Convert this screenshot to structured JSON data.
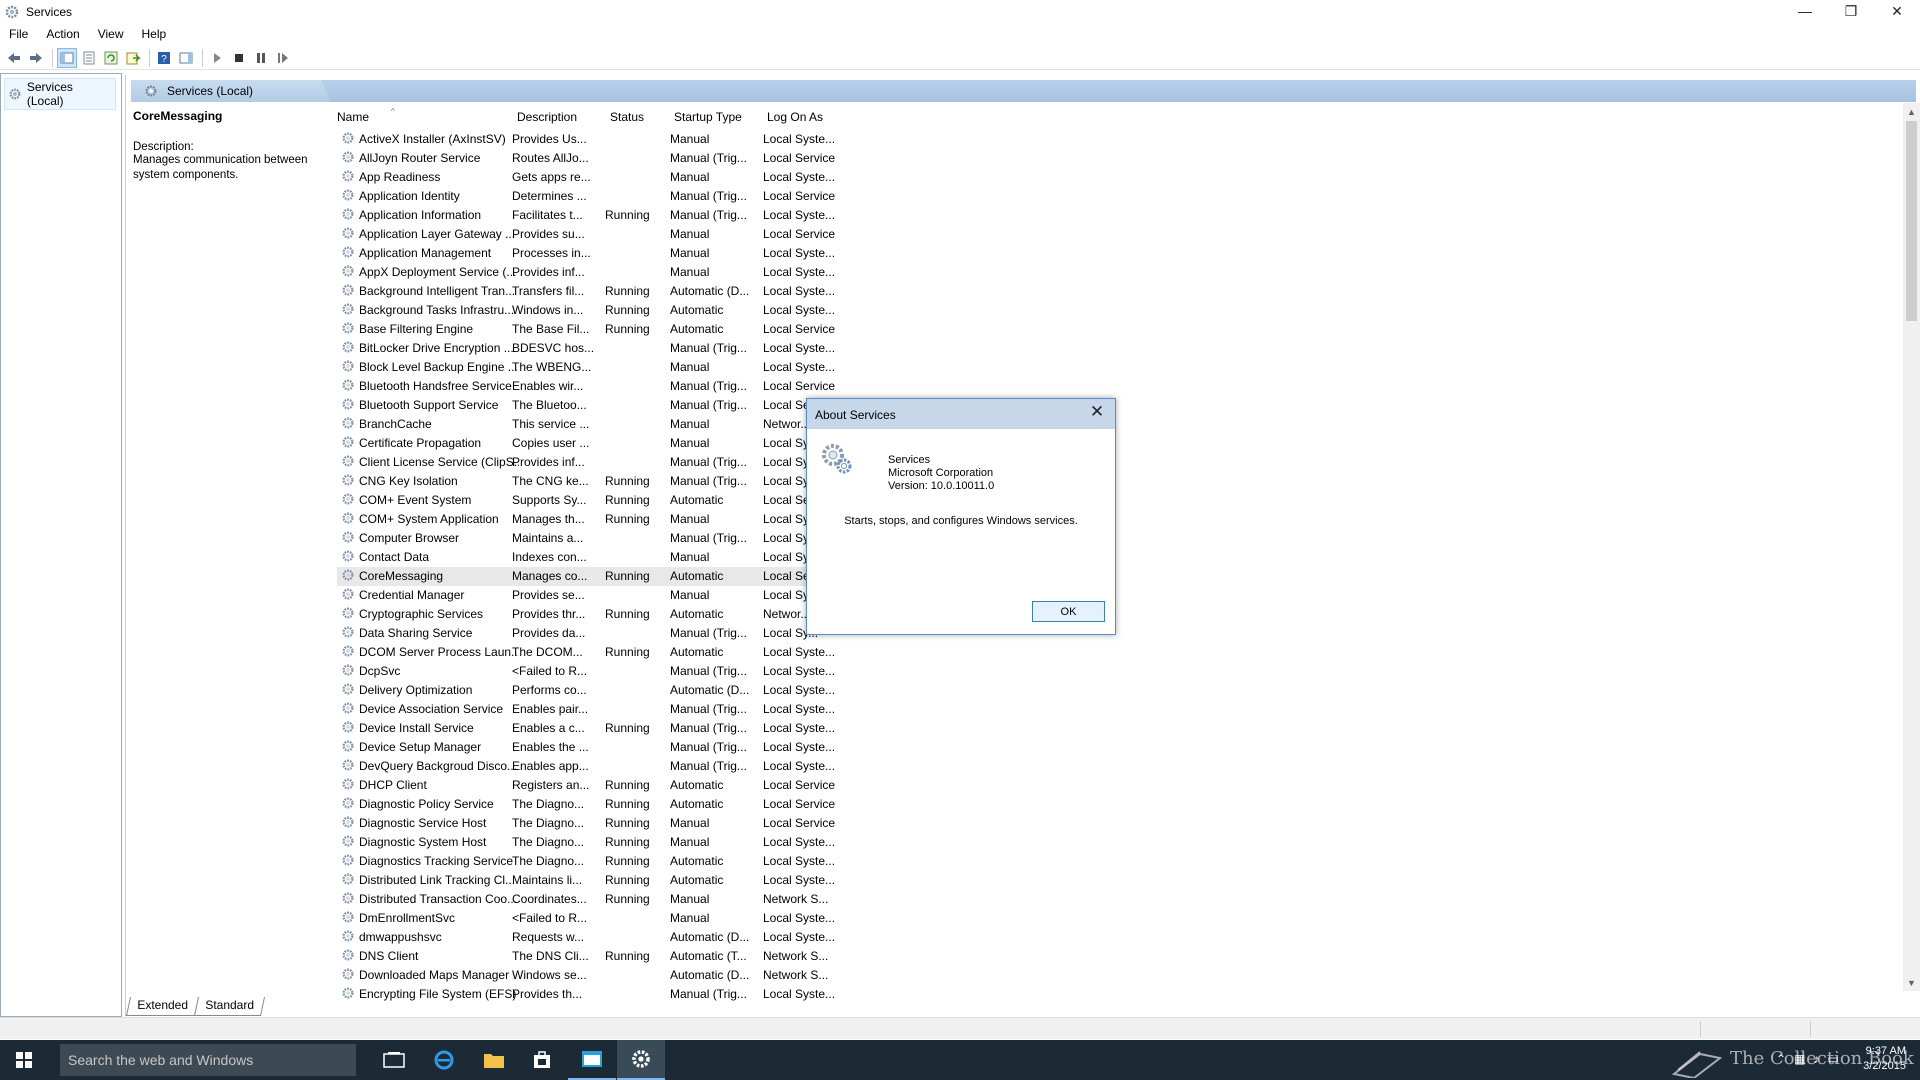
{
  "window": {
    "title": "Services",
    "minimize": "—",
    "restore": "❐",
    "close": "✕"
  },
  "menu": [
    "File",
    "Action",
    "View",
    "Help"
  ],
  "tree": {
    "root_label": "Services (Local)"
  },
  "pane": {
    "header_title": "Services (Local)",
    "selected_service": "CoreMessaging",
    "description_label": "Description:",
    "description_text": "Manages communication between system components."
  },
  "columns": [
    "Name",
    "Description",
    "Status",
    "Startup Type",
    "Log On As"
  ],
  "services": [
    [
      "ActiveX Installer (AxInstSV)",
      "Provides Us...",
      "",
      "Manual",
      "Local Syste..."
    ],
    [
      "AllJoyn Router Service",
      "Routes AllJo...",
      "",
      "Manual (Trig...",
      "Local Service"
    ],
    [
      "App Readiness",
      "Gets apps re...",
      "",
      "Manual",
      "Local Syste..."
    ],
    [
      "Application Identity",
      "Determines ...",
      "",
      "Manual (Trig...",
      "Local Service"
    ],
    [
      "Application Information",
      "Facilitates t...",
      "Running",
      "Manual (Trig...",
      "Local Syste..."
    ],
    [
      "Application Layer Gateway ...",
      "Provides su...",
      "",
      "Manual",
      "Local Service"
    ],
    [
      "Application Management",
      "Processes in...",
      "",
      "Manual",
      "Local Syste..."
    ],
    [
      "AppX Deployment Service (...",
      "Provides inf...",
      "",
      "Manual",
      "Local Syste..."
    ],
    [
      "Background Intelligent Tran...",
      "Transfers fil...",
      "Running",
      "Automatic (D...",
      "Local Syste..."
    ],
    [
      "Background Tasks Infrastru...",
      "Windows in...",
      "Running",
      "Automatic",
      "Local Syste..."
    ],
    [
      "Base Filtering Engine",
      "The Base Fil...",
      "Running",
      "Automatic",
      "Local Service"
    ],
    [
      "BitLocker Drive Encryption ...",
      "BDESVC hos...",
      "",
      "Manual (Trig...",
      "Local Syste..."
    ],
    [
      "Block Level Backup Engine ...",
      "The WBENG...",
      "",
      "Manual",
      "Local Syste..."
    ],
    [
      "Bluetooth Handsfree Service",
      "Enables wir...",
      "",
      "Manual (Trig...",
      "Local Service"
    ],
    [
      "Bluetooth Support Service",
      "The Bluetoo...",
      "",
      "Manual (Trig...",
      "Local Se..."
    ],
    [
      "BranchCache",
      "This service ...",
      "",
      "Manual",
      "Networ..."
    ],
    [
      "Certificate Propagation",
      "Copies user ...",
      "",
      "Manual",
      "Local Sy..."
    ],
    [
      "Client License Service (ClipS...",
      "Provides inf...",
      "",
      "Manual (Trig...",
      "Local Sy..."
    ],
    [
      "CNG Key Isolation",
      "The CNG ke...",
      "Running",
      "Manual (Trig...",
      "Local Sy..."
    ],
    [
      "COM+ Event System",
      "Supports Sy...",
      "Running",
      "Automatic",
      "Local Se..."
    ],
    [
      "COM+ System Application",
      "Manages th...",
      "Running",
      "Manual",
      "Local Sy..."
    ],
    [
      "Computer Browser",
      "Maintains a...",
      "",
      "Manual (Trig...",
      "Local Sy..."
    ],
    [
      "Contact Data",
      "Indexes con...",
      "",
      "Manual",
      "Local Sy..."
    ],
    [
      "CoreMessaging",
      "Manages co...",
      "Running",
      "Automatic",
      "Local Se..."
    ],
    [
      "Credential Manager",
      "Provides se...",
      "",
      "Manual",
      "Local Sy..."
    ],
    [
      "Cryptographic Services",
      "Provides thr...",
      "Running",
      "Automatic",
      "Networ..."
    ],
    [
      "Data Sharing Service",
      "Provides da...",
      "",
      "Manual (Trig...",
      "Local Sy..."
    ],
    [
      "DCOM Server Process Laun...",
      "The DCOM...",
      "Running",
      "Automatic",
      "Local Syste..."
    ],
    [
      "DcpSvc",
      "<Failed to R...",
      "",
      "Manual (Trig...",
      "Local Syste..."
    ],
    [
      "Delivery Optimization",
      "Performs co...",
      "",
      "Automatic (D...",
      "Local Syste..."
    ],
    [
      "Device Association Service",
      "Enables pair...",
      "",
      "Manual (Trig...",
      "Local Syste..."
    ],
    [
      "Device Install Service",
      "Enables a c...",
      "Running",
      "Manual (Trig...",
      "Local Syste..."
    ],
    [
      "Device Setup Manager",
      "Enables the ...",
      "",
      "Manual (Trig...",
      "Local Syste..."
    ],
    [
      "DevQuery Backgroud Disco...",
      "Enables app...",
      "",
      "Manual (Trig...",
      "Local Syste..."
    ],
    [
      "DHCP Client",
      "Registers an...",
      "Running",
      "Automatic",
      "Local Service"
    ],
    [
      "Diagnostic Policy Service",
      "The Diagno...",
      "Running",
      "Automatic",
      "Local Service"
    ],
    [
      "Diagnostic Service Host",
      "The Diagno...",
      "Running",
      "Manual",
      "Local Service"
    ],
    [
      "Diagnostic System Host",
      "The Diagno...",
      "Running",
      "Manual",
      "Local Syste..."
    ],
    [
      "Diagnostics Tracking Service",
      "The Diagno...",
      "Running",
      "Automatic",
      "Local Syste..."
    ],
    [
      "Distributed Link Tracking Cl...",
      "Maintains li...",
      "Running",
      "Automatic",
      "Local Syste..."
    ],
    [
      "Distributed Transaction Coo...",
      "Coordinates...",
      "Running",
      "Manual",
      "Network S..."
    ],
    [
      "DmEnrollmentSvc",
      "<Failed to R...",
      "",
      "Manual",
      "Local Syste..."
    ],
    [
      "dmwappushsvc",
      "Requests w...",
      "",
      "Automatic (D...",
      "Local Syste..."
    ],
    [
      "DNS Client",
      "The DNS Cli...",
      "Running",
      "Automatic (T...",
      "Network S..."
    ],
    [
      "Downloaded Maps Manager",
      "Windows se...",
      "",
      "Automatic (D...",
      "Network S..."
    ],
    [
      "Encrypting File System (EFS)",
      "Provides th...",
      "",
      "Manual (Trig...",
      "Local Syste..."
    ]
  ],
  "selected_index": 23,
  "bottom_tabs": [
    "Extended",
    "Standard"
  ],
  "dialog": {
    "title": "About Services",
    "close": "✕",
    "line1": "Services",
    "line2": "Microsoft Corporation",
    "line3": "Version: 10.0.10011.0",
    "line4": "Starts, stops, and configures Windows services.",
    "ok": "OK"
  },
  "taskbar": {
    "search_placeholder": "Search the web and Windows",
    "watermark": "The Collection Book",
    "time": "9:37 AM",
    "date": "3/2/2015"
  },
  "colors": {
    "pane_header": "#b9d1ea",
    "taskbar": "#1c2a35",
    "dialog_title": "#c6d7ea",
    "selected_row": "#e8e8e8"
  }
}
